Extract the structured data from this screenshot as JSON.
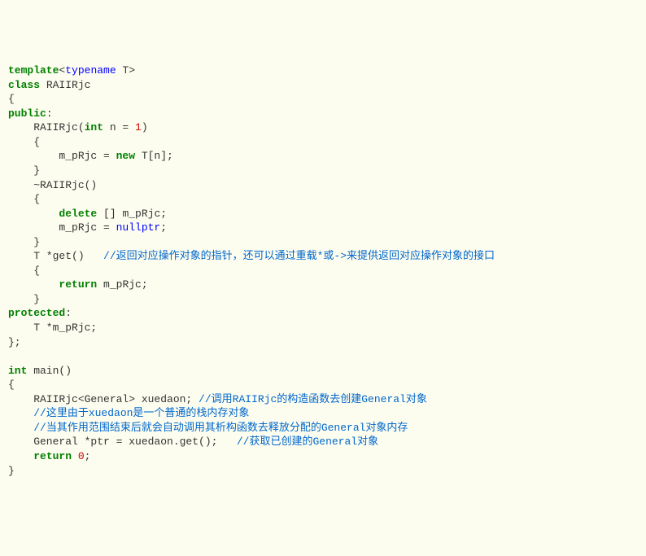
{
  "code": {
    "l1": {
      "a": "template",
      "b": "<",
      "c": "typename",
      "d": " T>"
    },
    "l2": {
      "a": "class",
      "b": " RAIIRjc"
    },
    "l3": "{",
    "l4": {
      "a": "public",
      "b": ":"
    },
    "l5": {
      "a": "    RAIIRjc(",
      "b": "int",
      "c": " n = ",
      "d": "1",
      "e": ")"
    },
    "l6": "    {",
    "l7": {
      "a": "        m_pRjc = ",
      "b": "new",
      "c": " T[n];"
    },
    "l8": "    }",
    "l9": "    ~RAIIRjc()",
    "l10": "    {",
    "l11": {
      "a": "        ",
      "b": "delete",
      "c": " [] m_pRjc;"
    },
    "l12": {
      "a": "        m_pRjc = ",
      "b": "nullptr",
      "c": ";"
    },
    "l13": "    }",
    "l14": {
      "a": "    T *get()   ",
      "b": "//返回对应操作对象的指针，还可以通过重载*或->来提供返回对应操作对象的接口"
    },
    "l15": "    {",
    "l16": {
      "a": "        ",
      "b": "return",
      "c": " m_pRjc;"
    },
    "l17": "    }",
    "l18": {
      "a": "protected",
      "b": ":"
    },
    "l19": "    T *m_pRjc;",
    "l20": "};",
    "l21": "",
    "l22": {
      "a": "int",
      "b": " main()"
    },
    "l23": "{",
    "l24": {
      "a": "    RAIIRjc<General> xuedaon; ",
      "b": "//调用RAIIRjc的构造函数去创建General对象"
    },
    "l25": {
      "a": "    ",
      "b": "//这里由于xuedaon是一个普通的栈内存对象"
    },
    "l26": {
      "a": "    ",
      "b": "//当其作用范围结束后就会自动调用其析构函数去释放分配的General对象内存"
    },
    "l27": {
      "a": "    General *ptr = xuedaon.get();   ",
      "b": "//获取已创建的General对象"
    },
    "l28": {
      "a": "    ",
      "b": "return",
      "c": " ",
      "d": "0",
      "e": ";"
    },
    "l29": "}"
  }
}
